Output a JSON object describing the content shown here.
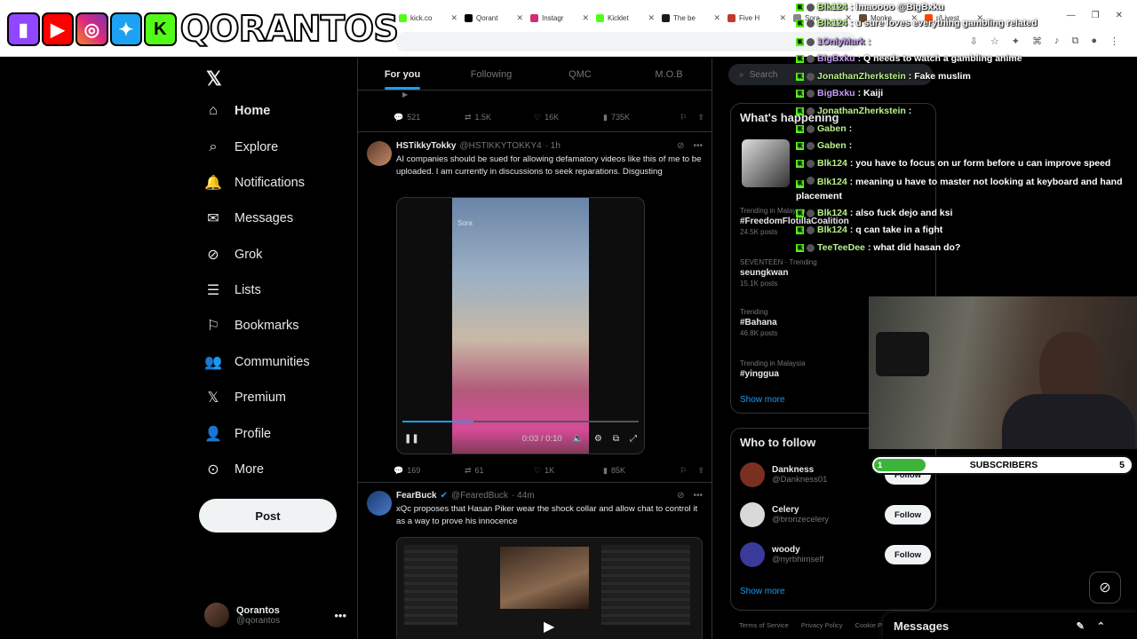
{
  "browser": {
    "tabs": [
      {
        "label": "kick.co",
        "color": "#53fc18"
      },
      {
        "label": "Qorant",
        "color": "#000000"
      },
      {
        "label": "Instagr",
        "color": "#d62976"
      },
      {
        "label": "Kicklet",
        "color": "#53fc18"
      },
      {
        "label": "The be",
        "color": "#1a1a1a"
      },
      {
        "label": "Five H",
        "color": "#c0392b"
      },
      {
        "label": "Sora",
        "color": "#888888"
      },
      {
        "label": "Monke",
        "color": "#6b4a2b"
      },
      {
        "label": "r/Livest",
        "color": "#ff4500"
      }
    ]
  },
  "banner": {
    "icons": [
      "twitch",
      "youtube",
      "instagram",
      "twitter",
      "kick"
    ],
    "name": "QORANTOS"
  },
  "nav": {
    "items": [
      {
        "label": "Home",
        "icon": "home-icon",
        "glyph": "⌂"
      },
      {
        "label": "Explore",
        "icon": "search-icon",
        "glyph": "⌕"
      },
      {
        "label": "Notifications",
        "icon": "bell-icon",
        "glyph": "🔔"
      },
      {
        "label": "Messages",
        "icon": "envelope-icon",
        "glyph": "✉"
      },
      {
        "label": "Grok",
        "icon": "grok-icon",
        "glyph": "⊘"
      },
      {
        "label": "Lists",
        "icon": "list-icon",
        "glyph": "☰"
      },
      {
        "label": "Bookmarks",
        "icon": "bookmark-icon",
        "glyph": "⚐"
      },
      {
        "label": "Communities",
        "icon": "people-icon",
        "glyph": "👥"
      },
      {
        "label": "Premium",
        "icon": "x-icon",
        "glyph": "𝕏"
      },
      {
        "label": "Profile",
        "icon": "person-icon",
        "glyph": "👤"
      },
      {
        "label": "More",
        "icon": "more-icon",
        "glyph": "⊙"
      }
    ],
    "post_label": "Post",
    "user": {
      "name": "Qorantos",
      "handle": "@qorantos"
    }
  },
  "feed": {
    "tabs": [
      "For you",
      "Following",
      "QMC",
      "M.O.B"
    ],
    "top_actions": {
      "replies": "521",
      "reposts": "1.5K",
      "likes": "16K",
      "views": "735K"
    },
    "tweet1": {
      "name": "HSTikkyTokky",
      "handle": "@HSTIKKYTOKKY4",
      "time": "· 1h",
      "text": "AI companies should be sued for allowing defamatory videos like this of me to be  uploaded. I am currently in discussions to seek reparations. Disgusting",
      "video_time": "0:03 / 0:10",
      "video_progress": 0.3,
      "watermark": "Sora",
      "actions": {
        "replies": "169",
        "reposts": "61",
        "likes": "1K",
        "views": "85K"
      }
    },
    "tweet2": {
      "name": "FearBuck",
      "handle": "@FearedBuck",
      "time": "· 44m",
      "text": "xQc proposes that Hasan Piker wear the shock collar and allow chat to control it as a way to prove his innocence"
    }
  },
  "right": {
    "search_placeholder": "Search",
    "happening_title": "What's happening",
    "trends": [
      {
        "context": "Trending in Malaysia",
        "title": "#FreedomFlotillaCoalition",
        "count": "24.5K posts"
      },
      {
        "context": "SEVENTEEN · Trending",
        "title": "seungkwan",
        "count": "15.1K posts"
      },
      {
        "context": "Trending",
        "title": "#Bahana",
        "count": "46.8K posts"
      },
      {
        "context": "Trending in Malaysia",
        "title": "#yinggua",
        "count": ""
      }
    ],
    "show_more": "Show more",
    "who_title": "Who to follow",
    "follow_label": "Follow",
    "follow": [
      {
        "name": "Dankness",
        "handle": "@Dankness01",
        "color": "#7a3020"
      },
      {
        "name": "Celery",
        "handle": "@bronzecelery",
        "color": "#d9d9d9"
      },
      {
        "name": "woody",
        "handle": "@nyrbhimself",
        "color": "#3a3a9a"
      }
    ],
    "footer": [
      "Terms of Service",
      "Privacy Policy",
      "Cookie P"
    ]
  },
  "chat": [
    {
      "user": "Blk124",
      "msg": ": lmaoooo @BigBxku",
      "color": "y"
    },
    {
      "user": "Blk124",
      "msg": ": u sure loves everything gambling related",
      "color": "y"
    },
    {
      "user": "1OnlyMark",
      "msg": ":",
      "color": "p"
    },
    {
      "user": "BigBxku",
      "msg": ": Q needs to watch a gambling anime",
      "color": "p"
    },
    {
      "user": "JonathanZherkstein",
      "msg": ": Fake muslim",
      "color": "y"
    },
    {
      "user": "BigBxku",
      "msg": ": Kaiji",
      "color": "p"
    },
    {
      "user": "JonathanZherkstein",
      "msg": ":",
      "color": "y"
    },
    {
      "user": "Gaben",
      "msg": ":",
      "color": "y"
    },
    {
      "user": "Gaben",
      "msg": ":",
      "color": "y"
    },
    {
      "user": "Blk124",
      "msg": ": you have to focus on ur form before u can improve speed",
      "color": "y"
    },
    {
      "user": "Blk124",
      "msg": ": meaning u have to master not looking at keyboard and hand placement",
      "color": "y"
    },
    {
      "user": "Blk124",
      "msg": ": also fuck dejo and ksi",
      "color": "y"
    },
    {
      "user": "Blk124",
      "msg": ": q can take    in a fight",
      "color": "y"
    },
    {
      "user": "TeeTeeDee",
      "msg": ": what did hasan do?",
      "color": "y"
    }
  ],
  "subs": {
    "current": "1",
    "label": "SUBSCRIBERS",
    "goal": "5",
    "progress": 0.2
  },
  "messages_drawer": {
    "title": "Messages"
  }
}
